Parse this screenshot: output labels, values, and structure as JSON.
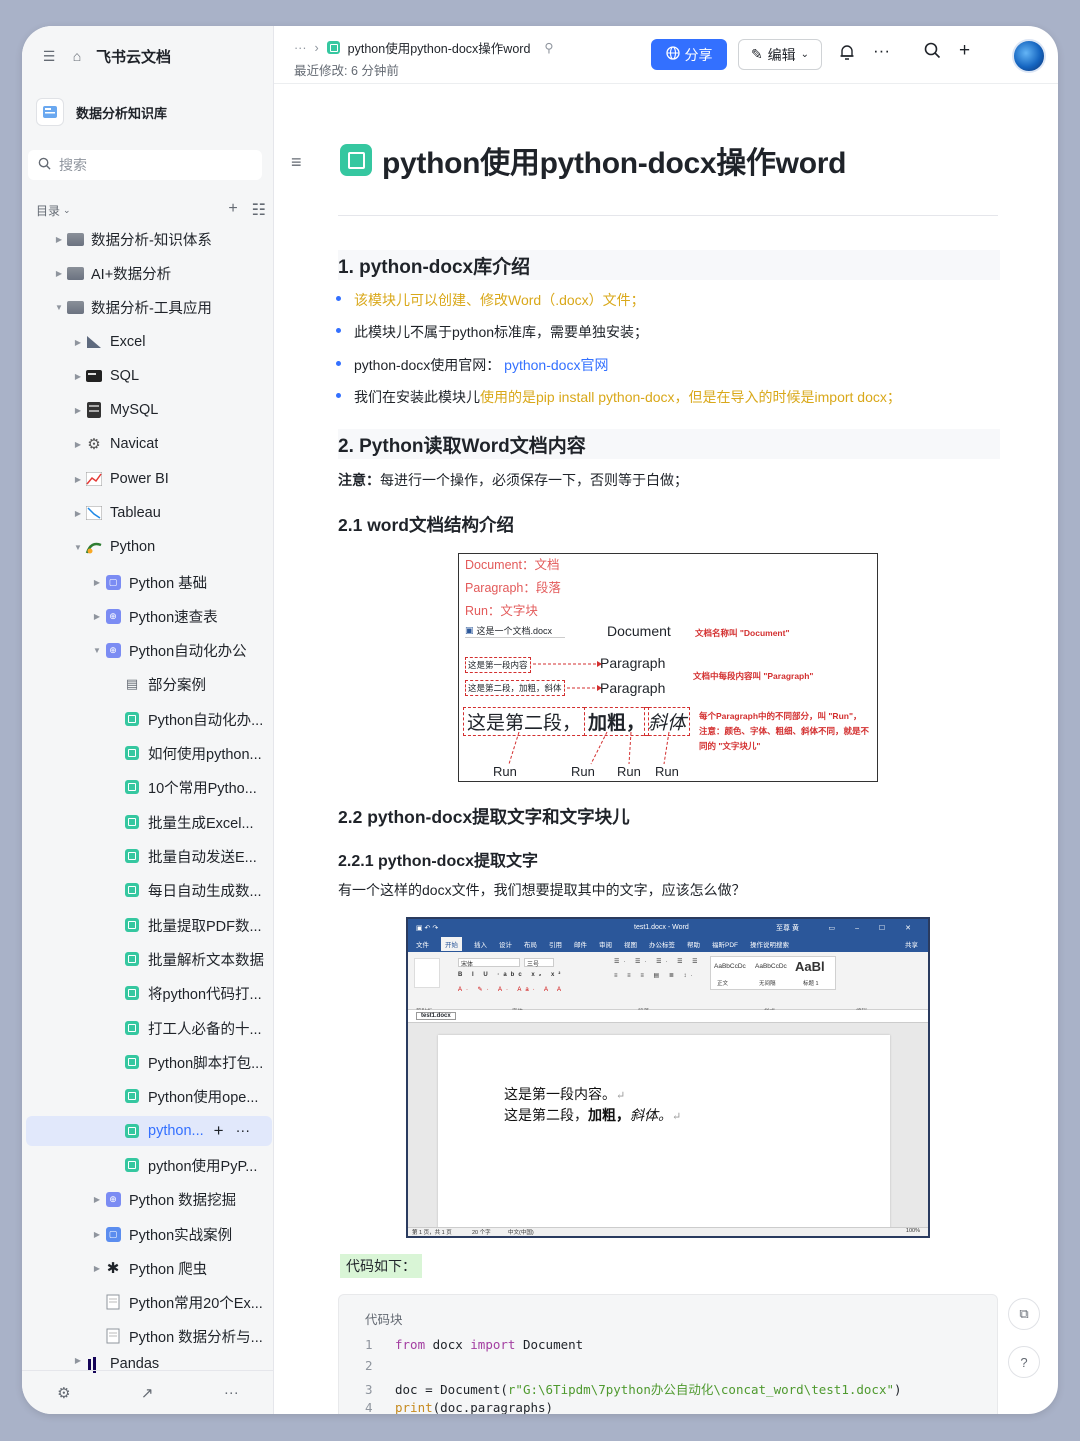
{
  "sidebar": {
    "app_name": "飞书云文档",
    "knowledge_base": "数据分析知识库",
    "search_placeholder": "搜索",
    "toc_label": "目录",
    "items": [
      {
        "label": "数据分析-知识体系",
        "icon": "folder-icon"
      },
      {
        "label": "AI+数据分析",
        "icon": "folder-icon"
      },
      {
        "label": "数据分析-工具应用",
        "icon": "folder-icon"
      },
      {
        "label": "Excel",
        "icon": "excel-icon"
      },
      {
        "label": "SQL",
        "icon": "sql-icon"
      },
      {
        "label": "MySQL",
        "icon": "mysql-icon"
      },
      {
        "label": "Navicat",
        "icon": "navicat-icon"
      },
      {
        "label": "Power BI",
        "icon": "powerbi-icon"
      },
      {
        "label": "Tableau",
        "icon": "tableau-icon"
      },
      {
        "label": "Python",
        "icon": "python-icon"
      },
      {
        "label": "Python 基础",
        "icon": "wiki-icon"
      },
      {
        "label": "Python速查表",
        "icon": "wiki-icon"
      },
      {
        "label": "Python自动化办公",
        "icon": "wiki-icon"
      },
      {
        "label": "部分案例",
        "icon": "doc-outline-icon"
      },
      {
        "label": "Python自动化办...",
        "icon": "doc-icon"
      },
      {
        "label": "如何使用python...",
        "icon": "doc-icon"
      },
      {
        "label": "10个常用Pytho...",
        "icon": "doc-icon"
      },
      {
        "label": "批量生成Excel...",
        "icon": "doc-icon"
      },
      {
        "label": "批量自动发送E...",
        "icon": "doc-icon"
      },
      {
        "label": "每日自动生成数...",
        "icon": "doc-icon"
      },
      {
        "label": "批量提取PDF数...",
        "icon": "doc-icon"
      },
      {
        "label": "批量解析文本数据",
        "icon": "doc-icon"
      },
      {
        "label": "将python代码打...",
        "icon": "doc-icon"
      },
      {
        "label": "打工人必备的十...",
        "icon": "doc-icon"
      },
      {
        "label": "Python脚本打包...",
        "icon": "doc-icon"
      },
      {
        "label": "Python使用ope...",
        "icon": "doc-icon"
      },
      {
        "label": "python...",
        "icon": "doc-icon"
      },
      {
        "label": "python使用PyP...",
        "icon": "doc-icon"
      },
      {
        "label": "Python 数据挖掘",
        "icon": "wiki-icon"
      },
      {
        "label": "Python实战案例",
        "icon": "wiki-icon"
      },
      {
        "label": "Python 爬虫",
        "icon": "spider-icon"
      },
      {
        "label": "Python常用20个Ex...",
        "icon": "page-icon"
      },
      {
        "label": "Python 数据分析与...",
        "icon": "page-icon"
      },
      {
        "label": "Pandas",
        "icon": "pandas-icon"
      }
    ]
  },
  "topbar": {
    "breadcrumb_ellipsis": "···",
    "doc_title": "python使用python-docx操作word",
    "modified": "最近修改: 6 分钟前",
    "share_label": "分享",
    "edit_label": "编辑"
  },
  "doc": {
    "title": "python使用python-docx操作word",
    "h1": "1. python-docx库介绍",
    "bullets": {
      "b1": "该模块儿可以创建、修改Word（.docx）文件；",
      "b2": "此模块儿不属于python标准库，需要单独安装；",
      "b3_prefix": "python-docx使用官网：",
      "b3_link": "python-docx官网",
      "b4_prefix": "我们在安装此模块儿",
      "b4_yellow": "使用的是pip install python-docx，但是在导入的时候是import docx；"
    },
    "h2": "2. Python读取Word文档内容",
    "note_bold": "注意：",
    "note_text": "每进行一个操作，必须保存一下，否则等于白做；",
    "h21": "2.1 word文档结构介绍",
    "h22": "2.2 python-docx提取文字和文字块儿",
    "h221": "2.2.1 python-docx提取文字",
    "question": "有一个这样的docx文件，我们想要提取其中的文字，应该怎么做？",
    "code_label": "代码如下：",
    "code_header": "代码块"
  },
  "figure1": {
    "doc_label": "Document：文档",
    "para_label": "Paragraph：段落",
    "run_label": "Run：文字块",
    "file_name": "这是一个文档.docx",
    "document": "Document",
    "doc_note": "文档名称叫 \"Document\"",
    "para1_box": "这是第一段内容",
    "para2_box": "这是第二段，加粗，斜体",
    "paragraph": "Paragraph",
    "para_note": "文档中每段内容叫 \"Paragraph\"",
    "run1": "这是第二段，",
    "run2": "加粗，",
    "run3": "斜体",
    "run_note1": "每个Paragraph中的不同部分，叫 \"Run\"，",
    "run_note2": "注意：颜色、字体、粗细、斜体不同，就是不",
    "run_note3": "同的 \"文字块儿\"",
    "run": "Run"
  },
  "figure2": {
    "window_title": "test1.docx  -  Word",
    "user": "至尊 黄",
    "tabs": [
      "文件",
      "开始",
      "插入",
      "设计",
      "布局",
      "引用",
      "邮件",
      "审阅",
      "视图",
      "办公标签",
      "帮助",
      "福昕PDF",
      "操作说明搜索",
      "共享"
    ],
    "font_name": "宋体",
    "font_size": "三号",
    "groups": [
      "剪贴板",
      "字体",
      "段落",
      "样式",
      "编辑"
    ],
    "styles": [
      "AaBbCcDc",
      "AaBbCcDc",
      "AaBl"
    ],
    "style_names": [
      "正文",
      "无间隔",
      "标题 1"
    ],
    "doc_tab": "test1.docx",
    "line1": "这是第一段内容。",
    "line2_a": "这是第二段，",
    "line2_b": "加粗，",
    "line2_c": "斜体。",
    "status_page": "第 1 页，共 1 页",
    "status_words": "20 个字",
    "status_lang": "中文(中国)",
    "zoom": "100%"
  },
  "code": {
    "lines": [
      {
        "n": "1"
      },
      {
        "n": "2"
      },
      {
        "n": "3"
      },
      {
        "n": "4"
      }
    ],
    "l1_kw1": "from",
    "l1_mod": "docx",
    "l1_kw2": "import",
    "l1_name": "Document",
    "l3_pre": "doc = Document(",
    "l3_str": "r\"G:\\6Tipdm\\7python办公自动化\\concat_word\\test1.docx\"",
    "l3_post": ")",
    "l4_fn": "print",
    "l4_rest": "(doc.paragraphs)"
  },
  "colors": {
    "accent": "#3370ff",
    "sidebar_bg": "#f5f6f7",
    "highlight": "#d9a81a"
  }
}
